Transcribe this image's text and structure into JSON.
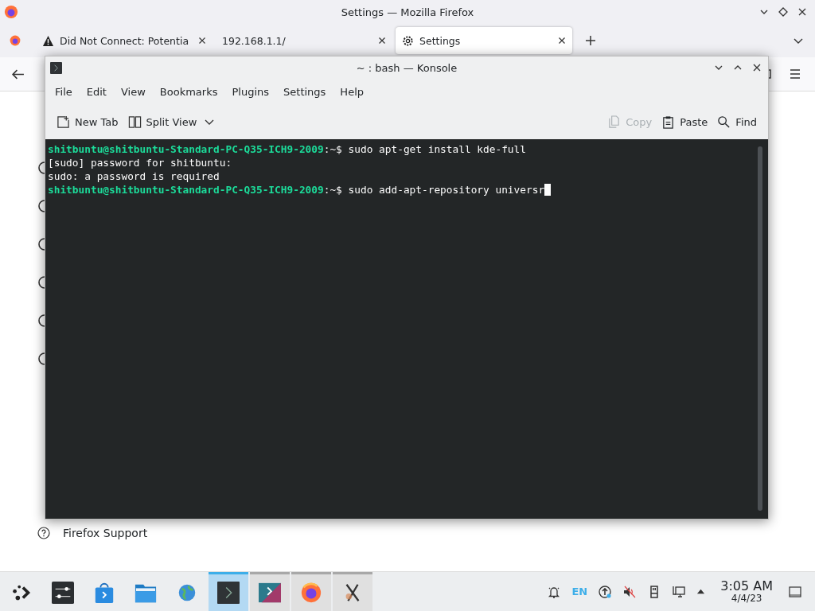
{
  "browser": {
    "title": "Settings — Mozilla Firefox",
    "tabs": [
      {
        "kind": "warning",
        "label": "Did Not Connect: Potentia",
        "selected": false
      },
      {
        "kind": "plain",
        "label": "192.168.1.1/",
        "selected": false
      },
      {
        "kind": "gear",
        "label": "Settings",
        "selected": true
      }
    ],
    "footer_link": "Firefox Support"
  },
  "konsole": {
    "title": "~ : bash — Konsole",
    "menu": [
      "File",
      "Edit",
      "View",
      "Bookmarks",
      "Plugins",
      "Settings",
      "Help"
    ],
    "toolbar_left": [
      {
        "kind": "new-tab",
        "label": "New Tab"
      },
      {
        "kind": "split",
        "label": "Split View"
      }
    ],
    "toolbar_right": [
      {
        "kind": "copy",
        "label": "Copy",
        "disabled": true
      },
      {
        "kind": "paste",
        "label": "Paste",
        "disabled": false
      },
      {
        "kind": "find",
        "label": "Find",
        "disabled": false
      }
    ],
    "lines": [
      {
        "kind": "prompt",
        "user": "shitbuntu@shitbuntu-Standard-PC-Q35-ICH9-2009",
        "path": ":~$",
        "command": "sudo apt-get install kde-full",
        "cursor": false
      },
      {
        "kind": "output",
        "text": "[sudo] password for shitbuntu:"
      },
      {
        "kind": "output",
        "text": "sudo: a password is required"
      },
      {
        "kind": "prompt",
        "user": "shitbuntu@shitbuntu-Standard-PC-Q35-ICH9-2009",
        "path": ":~$",
        "command": "sudo add-apt-repository universr",
        "cursor": true
      }
    ]
  },
  "taskbar": {
    "apps": [
      {
        "kind": "launcher",
        "selected": false,
        "running": false
      },
      {
        "kind": "settings",
        "selected": false,
        "running": false
      },
      {
        "kind": "store",
        "selected": false,
        "running": false
      },
      {
        "kind": "files",
        "selected": false,
        "running": false
      },
      {
        "kind": "globe",
        "selected": false,
        "running": false
      },
      {
        "kind": "terminal",
        "selected": true,
        "running": true
      },
      {
        "kind": "kde",
        "selected": false,
        "running": true
      },
      {
        "kind": "firefox",
        "selected": false,
        "running": true
      },
      {
        "kind": "x",
        "selected": false,
        "running": true
      }
    ],
    "language": "EN",
    "time": "3:05 AM",
    "date": "4/4/23"
  }
}
